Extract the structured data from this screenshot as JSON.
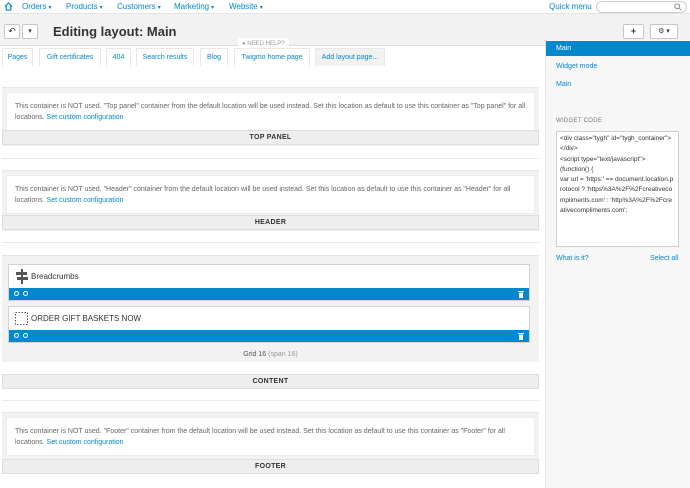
{
  "topnav": {
    "items": [
      {
        "label": "Orders",
        "caret": "▾"
      },
      {
        "label": "Products",
        "caret": "▾"
      },
      {
        "label": "Customers",
        "caret": "▾"
      },
      {
        "label": "Marketing",
        "caret": "▾"
      },
      {
        "label": "Website",
        "caret": "▾"
      }
    ],
    "quick_menu": "Quick menu",
    "search_placeholder": ""
  },
  "header": {
    "title": "Editing layout: Main",
    "back_label": "↶",
    "dropdown_label": "▾",
    "add_label": "+",
    "settings_label": "⚙ ▾"
  },
  "need_help": "● NEED HELP?",
  "tabs": [
    {
      "label": "Pages"
    },
    {
      "label": "Gift certificates"
    },
    {
      "label": "404"
    },
    {
      "label": "Search results"
    },
    {
      "label": "Blog"
    },
    {
      "label": "Twigmo home page"
    },
    {
      "label": "Add layout page..."
    }
  ],
  "containers": {
    "top_panel": {
      "message": "This container is NOT used. \"Top panel\" container from the default location will be used instead. Set this location as default to use this container as \"Top panel\" for all locations.",
      "link": "Set custom configuration",
      "label": "TOP PANEL"
    },
    "header": {
      "message": "This container is NOT used. \"Header\" container from the default location will be used instead. Set this location as default to use this container as \"Header\" for all locations.",
      "link": "Set custom configuration",
      "label": "HEADER"
    },
    "content": {
      "blocks": [
        {
          "title": "Breadcrumbs",
          "icon": "signpost-icon"
        },
        {
          "title": "ORDER GIFT BASKETS NOW",
          "icon": "dotted-square-icon"
        }
      ],
      "grid_label": "Grid 16",
      "grid_span": "(span 16)",
      "label": "CONTENT"
    },
    "footer": {
      "message": "This container is NOT used. \"Footer\" container from the default location will be used instead. Set this location as default to use this container as \"Footer\" for all locations.",
      "link": "Set custom configuration",
      "label": "FOOTER"
    }
  },
  "sidebar": {
    "items": [
      {
        "label": "Main",
        "active": true
      },
      {
        "label": "Widget mode",
        "active": false
      },
      {
        "label": "Main",
        "active": false
      }
    ],
    "widget_code_heading": "WIDGET CODE",
    "widget_code": "<div class=\"tygh\" id=\"tygh_container\">\n</div>\n<script type=\"text/javascript\">\n(function() {\nvar url = 'https:' == document.location.protocol ? 'https%3A%2F%2Fcreativecompliments.com' : 'http%3A%2F%2Fcreativecompliments.com';",
    "what_is_it": "What is it?",
    "select_all": "Select all"
  },
  "colors": {
    "accent": "#0388cc",
    "header_bg": "#f2f2f2",
    "sidebar_bg": "#f7f7f7"
  }
}
